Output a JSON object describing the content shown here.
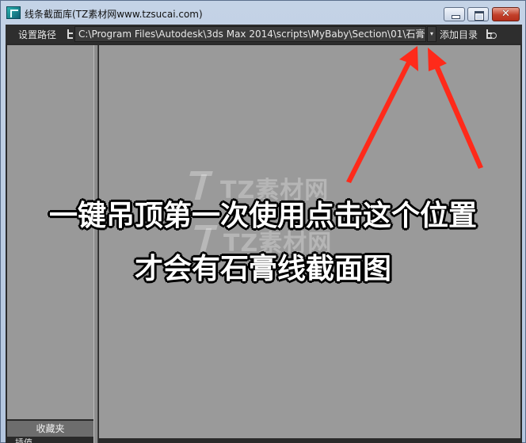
{
  "window": {
    "title": "线条截面库(TZ素材网www.tzsucai.com)",
    "minimize_glyph": "",
    "maximize_glyph": "",
    "close_glyph": "✕"
  },
  "toolbar": {
    "set_path_label": "设置路径",
    "path_value": "C:\\Program Files\\Autodesk\\3ds Max 2014\\scripts\\MyBaby\\Section\\01\\石膏",
    "dropdown_glyph": "▾",
    "add_directory_label": "添加目录"
  },
  "left_panel": {
    "favorites_label": "收藏夹",
    "bottom_label": "插值"
  },
  "watermarks": [
    "TZ素材网",
    "TZ素材网"
  ],
  "caption": {
    "line1": "一键吊顶第一次使用点击这个位置",
    "line2": "才会有石膏线截面图"
  },
  "colors": {
    "toolbar_bg": "#2e2e2e",
    "panel_bg": "#999999",
    "arrow": "#ff2a1a"
  }
}
